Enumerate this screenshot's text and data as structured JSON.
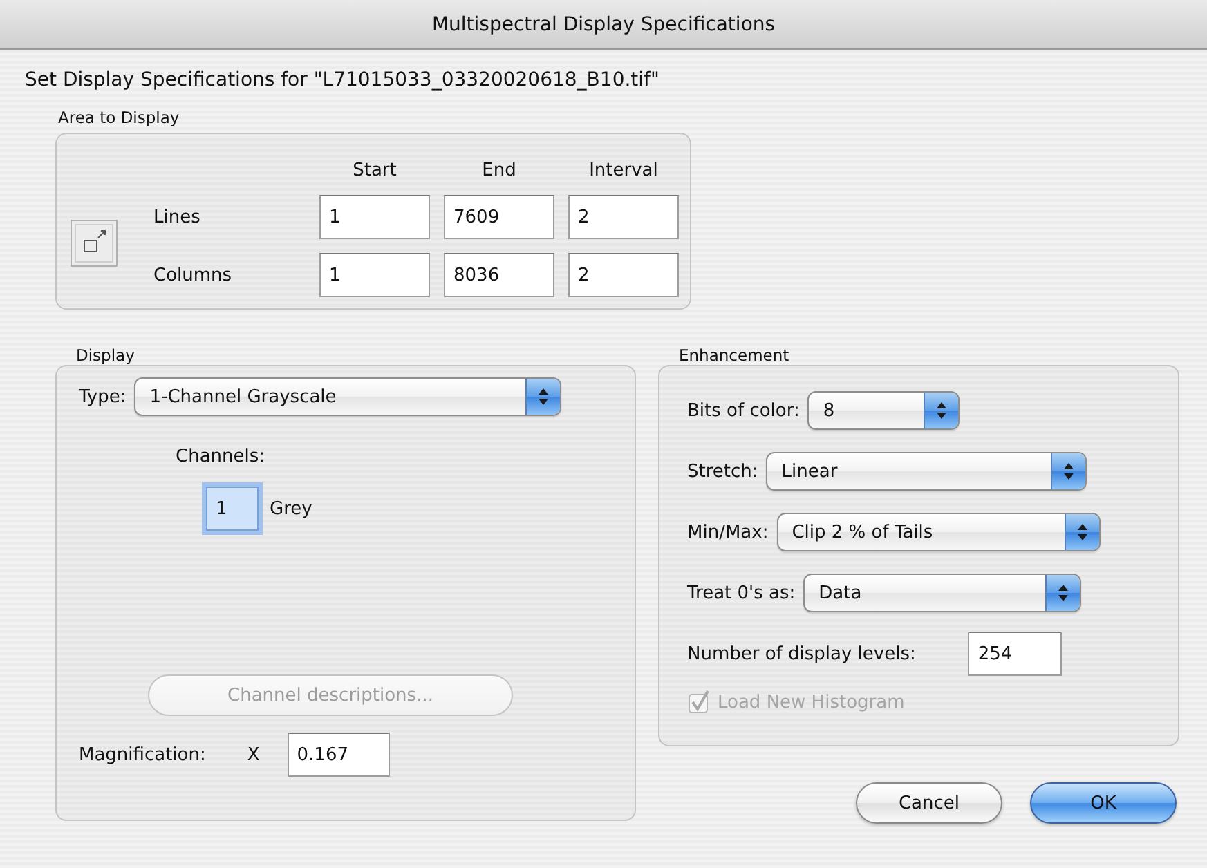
{
  "window": {
    "title": "Multispectral Display Specifications"
  },
  "heading": "Set Display Specifications for \"L71015033_03320020618_B10.tif\"",
  "area": {
    "label": "Area to Display",
    "columns": [
      "Start",
      "End",
      "Interval"
    ],
    "rows": [
      {
        "label": "Lines",
        "values": [
          "1",
          "7609",
          "2"
        ]
      },
      {
        "label": "Columns",
        "values": [
          "1",
          "8036",
          "2"
        ]
      }
    ]
  },
  "display": {
    "label": "Display",
    "type": {
      "label": "Type:",
      "value": "1-Channel Grayscale"
    },
    "channels_label": "Channels:",
    "channels": [
      {
        "value": "1",
        "name": "Grey",
        "focused": true
      }
    ],
    "descriptions_button": {
      "label": "Channel descriptions...",
      "disabled": true
    },
    "magnification": {
      "label": "Magnification:",
      "prefix": "X",
      "value": "0.167"
    }
  },
  "enhancement": {
    "label": "Enhancement",
    "popups": [
      {
        "label": "Bits of color:",
        "value": "8"
      },
      {
        "label": "Stretch:",
        "value": "Linear"
      },
      {
        "label": "Min/Max:",
        "value": "Clip 2 % of Tails"
      },
      {
        "label": "Treat 0's as:",
        "value": "Data"
      }
    ],
    "levels": {
      "label": "Number of display levels:",
      "value": "254"
    },
    "histogram": {
      "label": "Load New Histogram",
      "checked": true,
      "disabled": true
    }
  },
  "buttons": [
    {
      "label": "Cancel",
      "default": false
    },
    {
      "label": "OK",
      "default": true
    }
  ]
}
